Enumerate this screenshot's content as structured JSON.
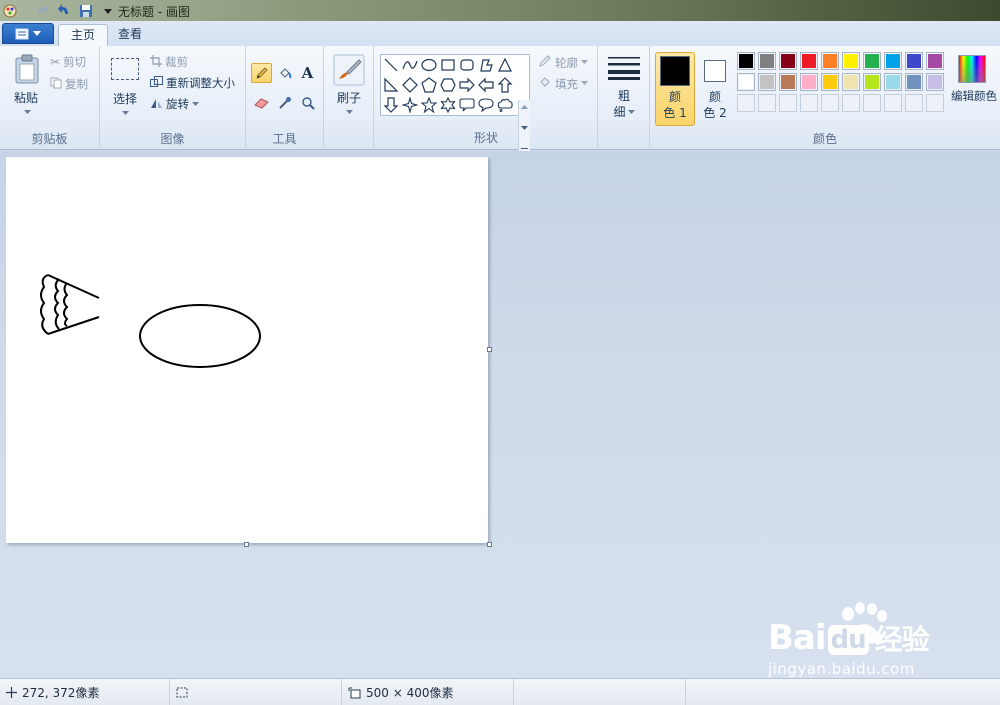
{
  "window": {
    "title": "无标题 - 画图"
  },
  "tabs": {
    "menu_label": "",
    "home": "主页",
    "view": "查看"
  },
  "clipboard": {
    "paste": "粘贴",
    "cut": "剪切",
    "copy": "复制",
    "group": "剪贴板"
  },
  "image": {
    "select": "选择",
    "crop": "裁剪",
    "resize": "重新调整大小",
    "rotate": "旋转",
    "group": "图像"
  },
  "tools": {
    "group": "工具",
    "text_glyph": "A"
  },
  "brushes": {
    "label": "刷子"
  },
  "shapes": {
    "group": "形状",
    "outline": "轮廓",
    "fill": "填充"
  },
  "size": {
    "label_line1": "粗",
    "label_line2": "细"
  },
  "colors": {
    "group": "颜色",
    "color1_line1": "颜",
    "color1_line2": "色 1",
    "color2_line1": "颜",
    "color2_line2": "色 2",
    "color1_value": "#000000",
    "color2_value": "#ffffff",
    "edit_colors": "编辑颜色",
    "palette_row1": [
      "#000000",
      "#7f7f7f",
      "#880015",
      "#ed1c24",
      "#ff7f27",
      "#fff200",
      "#22b14c",
      "#00a2e8",
      "#3f48cc",
      "#a349a4"
    ],
    "palette_row2": [
      "#ffffff",
      "#c3c3c3",
      "#b97a57",
      "#ffaec9",
      "#ffc90e",
      "#efe4b0",
      "#b5e61d",
      "#99d9ea",
      "#7092be",
      "#c8bfe7"
    ]
  },
  "status": {
    "position": "272, 372像素",
    "canvas_size": "500 × 400像素"
  },
  "watermark": {
    "brand": "Bai",
    "brand2": "du",
    "cn": "经验",
    "url": "jingyan.baidu.com"
  }
}
